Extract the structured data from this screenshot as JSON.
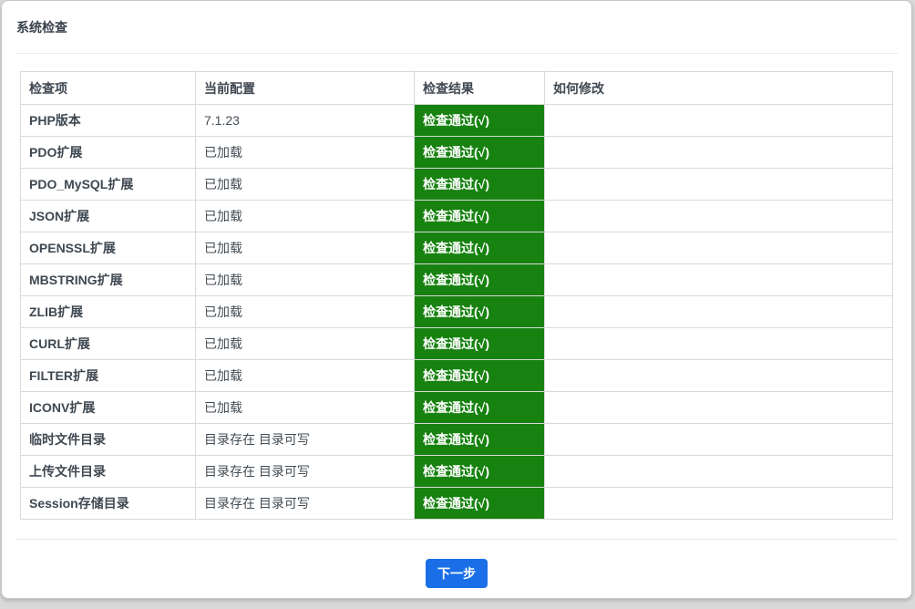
{
  "page": {
    "title": "系统检查"
  },
  "table": {
    "headers": [
      "检查项",
      "当前配置",
      "检查结果",
      "如何修改"
    ],
    "rows": [
      {
        "item": "PHP版本",
        "config": "7.1.23",
        "result": "检查通过(√)",
        "fix": ""
      },
      {
        "item": "PDO扩展",
        "config": "已加载",
        "result": "检查通过(√)",
        "fix": ""
      },
      {
        "item": "PDO_MySQL扩展",
        "config": "已加载",
        "result": "检查通过(√)",
        "fix": ""
      },
      {
        "item": "JSON扩展",
        "config": "已加载",
        "result": "检查通过(√)",
        "fix": ""
      },
      {
        "item": "OPENSSL扩展",
        "config": "已加载",
        "result": "检查通过(√)",
        "fix": ""
      },
      {
        "item": "MBSTRING扩展",
        "config": "已加载",
        "result": "检查通过(√)",
        "fix": ""
      },
      {
        "item": "ZLIB扩展",
        "config": "已加载",
        "result": "检查通过(√)",
        "fix": ""
      },
      {
        "item": "CURL扩展",
        "config": "已加载",
        "result": "检查通过(√)",
        "fix": ""
      },
      {
        "item": "FILTER扩展",
        "config": "已加载",
        "result": "检查通过(√)",
        "fix": ""
      },
      {
        "item": "ICONV扩展",
        "config": "已加载",
        "result": "检查通过(√)",
        "fix": ""
      },
      {
        "item": "临时文件目录",
        "config": "目录存在 目录可写",
        "result": "检查通过(√)",
        "fix": ""
      },
      {
        "item": "上传文件目录",
        "config": "目录存在 目录可写",
        "result": "检查通过(√)",
        "fix": ""
      },
      {
        "item": "Session存储目录",
        "config": "目录存在 目录可写",
        "result": "检查通过(√)",
        "fix": ""
      }
    ]
  },
  "footer": {
    "next_button_label": "下一步"
  },
  "colors": {
    "pass_green": "#178210",
    "primary_blue": "#1a6fe8",
    "table_border": "#d9d9d9"
  }
}
